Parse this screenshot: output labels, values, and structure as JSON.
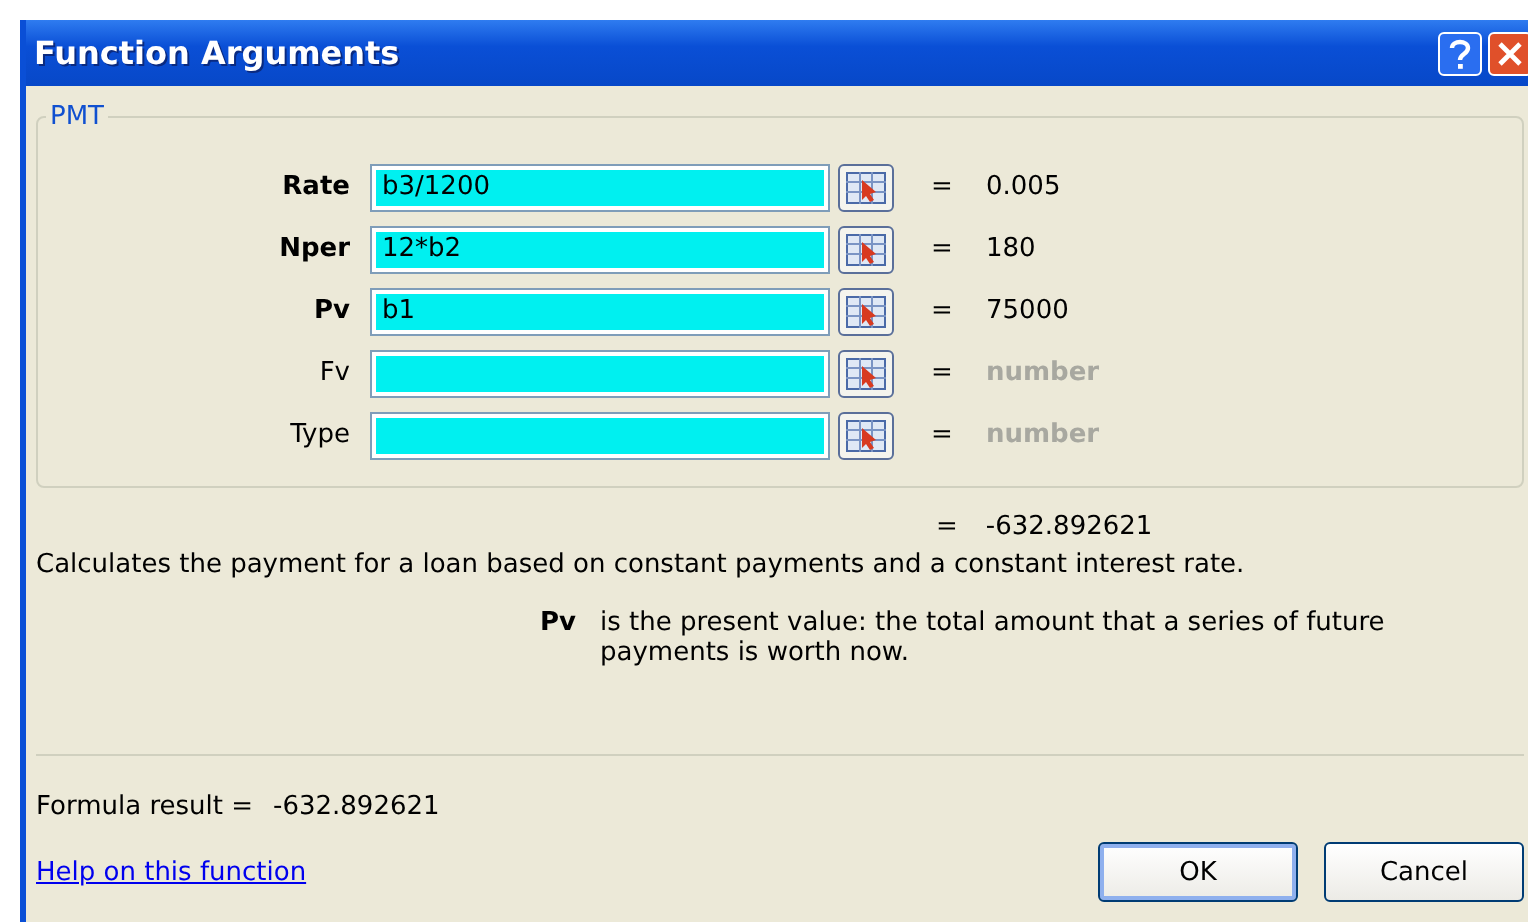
{
  "window": {
    "title": "Function Arguments"
  },
  "group": {
    "title": "PMT"
  },
  "arguments": [
    {
      "label": "Rate",
      "required": true,
      "value": "b3/1200",
      "equals": "=",
      "result": {
        "kind": "value",
        "text": "0.005"
      }
    },
    {
      "label": "Nper",
      "required": true,
      "value": "12*b2",
      "equals": "=",
      "result": {
        "kind": "value",
        "text": "180"
      }
    },
    {
      "label": "Pv",
      "required": true,
      "value": "b1",
      "equals": "=",
      "result": {
        "kind": "value",
        "text": "75000"
      }
    },
    {
      "label": "Fv",
      "required": false,
      "equals": "=",
      "result": {
        "kind": "type",
        "text": "number"
      }
    },
    {
      "label": "Type",
      "required": false,
      "equals": "=",
      "result": {
        "kind": "type",
        "text": "number"
      }
    }
  ],
  "function_result": {
    "equals": "=",
    "value": "-632.892621"
  },
  "description": "Calculates the payment for a loan based on constant payments and a constant interest rate.",
  "argument_help": {
    "name": "Pv",
    "text": "is the present value: the total amount that a series of future payments is worth now."
  },
  "formula_result": {
    "label": "Formula result =",
    "value": "-632.892621"
  },
  "help_link": "Help on this function",
  "buttons": [
    "OK",
    "Cancel"
  ]
}
